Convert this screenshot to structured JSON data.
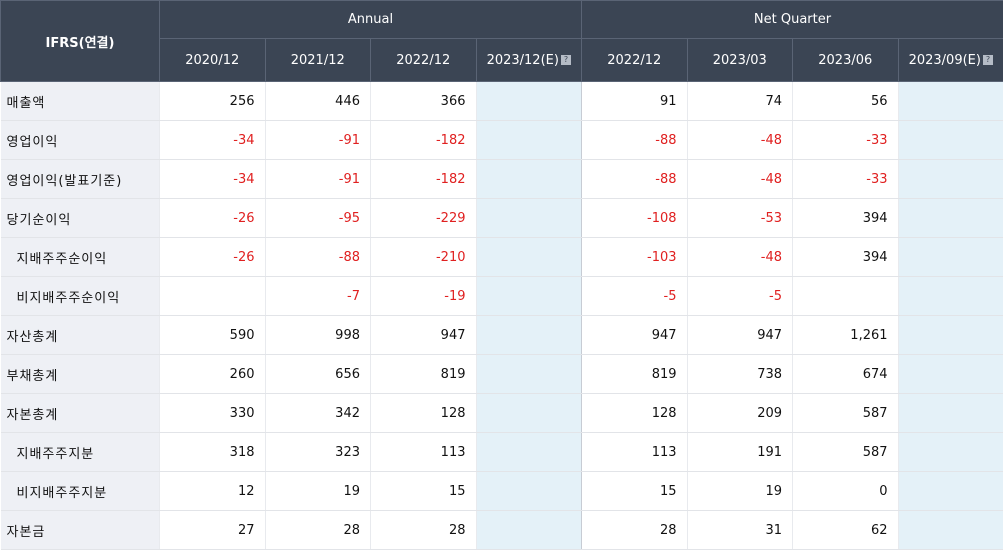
{
  "header": {
    "corner": "IFRS(연결)",
    "annual": "Annual",
    "quarter": "Net Quarter",
    "annual_periods": [
      "2020/12",
      "2021/12",
      "2022/12",
      "2023/12(E)"
    ],
    "quarter_periods": [
      "2022/12",
      "2023/03",
      "2023/06",
      "2023/09(E)"
    ],
    "estimate_icon": "question-icon"
  },
  "rows": [
    {
      "label": "매출액",
      "sub": false,
      "annual": [
        "256",
        "446",
        "366",
        ""
      ],
      "quarter": [
        "91",
        "74",
        "56",
        ""
      ]
    },
    {
      "label": "영업이익",
      "sub": false,
      "annual": [
        "-34",
        "-91",
        "-182",
        ""
      ],
      "quarter": [
        "-88",
        "-48",
        "-33",
        ""
      ]
    },
    {
      "label": "영업이익(발표기준)",
      "sub": false,
      "annual": [
        "-34",
        "-91",
        "-182",
        ""
      ],
      "quarter": [
        "-88",
        "-48",
        "-33",
        ""
      ]
    },
    {
      "label": "당기순이익",
      "sub": false,
      "annual": [
        "-26",
        "-95",
        "-229",
        ""
      ],
      "quarter": [
        "-108",
        "-53",
        "394",
        ""
      ]
    },
    {
      "label": "지배주주순이익",
      "sub": true,
      "annual": [
        "-26",
        "-88",
        "-210",
        ""
      ],
      "quarter": [
        "-103",
        "-48",
        "394",
        ""
      ]
    },
    {
      "label": "비지배주주순이익",
      "sub": true,
      "annual": [
        "",
        "-7",
        "-19",
        ""
      ],
      "quarter": [
        "-5",
        "-5",
        "",
        ""
      ]
    },
    {
      "label": "자산총계",
      "sub": false,
      "annual": [
        "590",
        "998",
        "947",
        ""
      ],
      "quarter": [
        "947",
        "947",
        "1,261",
        ""
      ]
    },
    {
      "label": "부채총계",
      "sub": false,
      "annual": [
        "260",
        "656",
        "819",
        ""
      ],
      "quarter": [
        "819",
        "738",
        "674",
        ""
      ]
    },
    {
      "label": "자본총계",
      "sub": false,
      "annual": [
        "330",
        "342",
        "128",
        ""
      ],
      "quarter": [
        "128",
        "209",
        "587",
        ""
      ]
    },
    {
      "label": "지배주주지분",
      "sub": true,
      "annual": [
        "318",
        "323",
        "113",
        ""
      ],
      "quarter": [
        "113",
        "191",
        "587",
        ""
      ]
    },
    {
      "label": "비지배주주지분",
      "sub": true,
      "annual": [
        "12",
        "19",
        "15",
        ""
      ],
      "quarter": [
        "15",
        "19",
        "0",
        ""
      ]
    },
    {
      "label": "자본금",
      "sub": false,
      "annual": [
        "27",
        "28",
        "28",
        ""
      ],
      "quarter": [
        "28",
        "31",
        "62",
        ""
      ]
    }
  ],
  "colors": {
    "header_bg": "#3b4554",
    "label_bg": "#eef0f5",
    "estimate_bg": "#e4f1f8",
    "negative": "#e02020"
  }
}
